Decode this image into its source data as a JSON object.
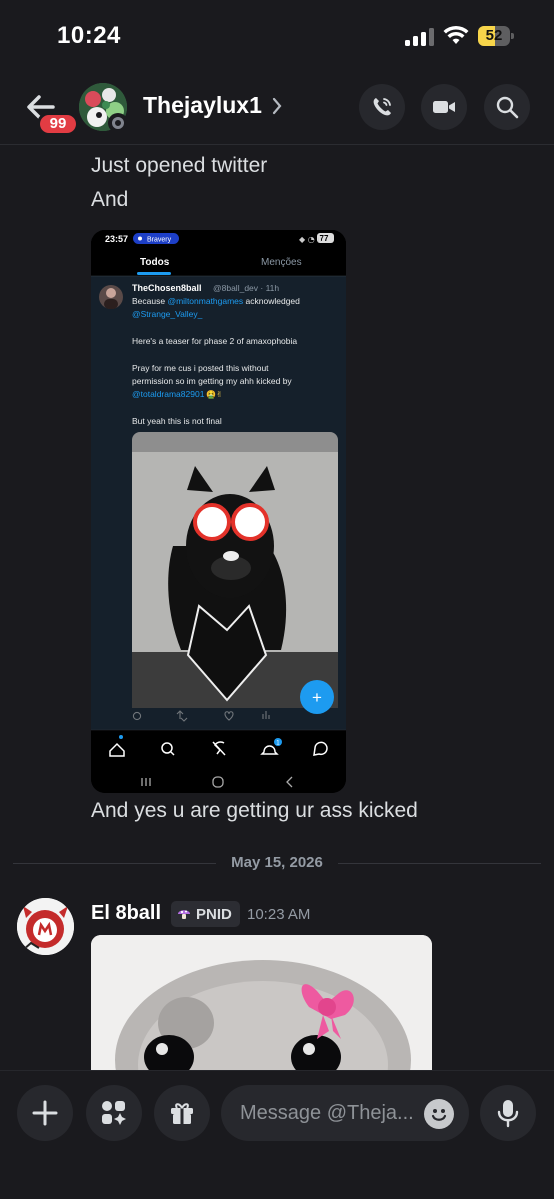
{
  "status_bar": {
    "time": "10:24",
    "battery": "52",
    "battery_level": 0.52
  },
  "header": {
    "unread_badge": "99",
    "username": "Thejaylux1"
  },
  "messages": {
    "line1": "Just opened twitter",
    "line2": "And",
    "line3": "And yes u are getting ur ass kicked"
  },
  "embedded_screenshot": {
    "time": "23:57",
    "app_pill": "Bravery",
    "battery": "77",
    "tabs": [
      "Todos",
      "Menções"
    ],
    "tweet": {
      "display_name": "TheChosen8ball",
      "handle_time": "@8ball_dev · 11h",
      "line1_prefix": "Because ",
      "mention1": "@miltonmathgames",
      "line1_suffix": " acknowledged",
      "mention2": "@Strange_Valley_",
      "paragraph2": "Here's a teaser for phase 2 of amaxophobia",
      "paragraph3a": "Pray for me cus i posted this without",
      "paragraph3b": "permission so im getting my ahh kicked by",
      "mention3": "@totaldrama82901",
      "emoji3": "🤮✌",
      "paragraph4": "But yeah this is not final"
    },
    "fab": "+",
    "nav_badge": "1"
  },
  "date_divider": "May 15, 2026",
  "second_message": {
    "author": "El 8ball",
    "tag": "PNID",
    "time": "10:23 AM"
  },
  "composer": {
    "placeholder": "Message @Theja..."
  },
  "colors": {
    "background": "#1a1a1e",
    "accent_blue": "#1d9bf0",
    "badge_red": "#e23c43",
    "tag_bg": "#2c2d33"
  }
}
